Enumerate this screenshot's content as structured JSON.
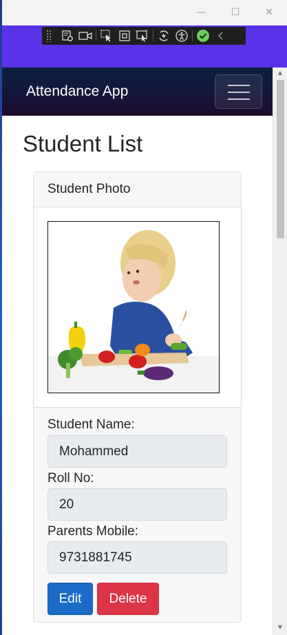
{
  "window": {
    "minimize_glyph": "—",
    "maximize_glyph": "☐",
    "close_glyph": "✕"
  },
  "devtools": {
    "icons": [
      "settings-device-icon",
      "video-icon",
      "select-element-icon",
      "frame-icon",
      "inspect-layout-icon",
      "hot-reload-icon",
      "accessibility-icon",
      "check-icon",
      "collapse-chevron-icon"
    ],
    "accent": "#5a32e8"
  },
  "navbar": {
    "brand": "Attendance App"
  },
  "page": {
    "title": "Student List"
  },
  "card": {
    "header": "Student Photo",
    "name_label": "Student Name:",
    "name_value": "Mohammed",
    "roll_label": "Roll No:",
    "roll_value": "20",
    "mobile_label": "Parents Mobile:",
    "mobile_value": "9731881745",
    "edit_label": "Edit",
    "delete_label": "Delete"
  },
  "colors": {
    "edit": "#1a6cc7",
    "delete": "#dc3545",
    "navbar": "#14163a"
  }
}
